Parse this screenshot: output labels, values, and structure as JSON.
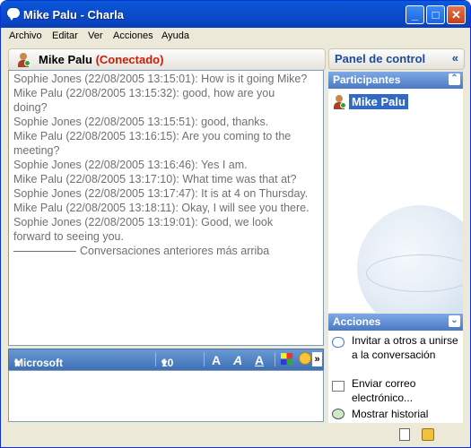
{
  "window": {
    "title": "Mike Palu - Charla",
    "min": "_",
    "max": "□",
    "close": "✕"
  },
  "menu": [
    "Archivo",
    "Editar",
    "Ver",
    "Acciones",
    "Ayuda"
  ],
  "chat": {
    "contact_name": "Mike Palu",
    "contact_status": "(Conectado)",
    "messages": [
      "Sophie Jones  (22/08/2005 13:15:01): How is it going Mike?",
      "Mike Palu  (22/08/2005 13:15:32): good, how are you doing?",
      "Sophie Jones  (22/08/2005 13:15:51): good, thanks.",
      "Mike Palu  (22/08/2005 13:16:15): Are you coming to the meeting?",
      "Sophie Jones  (22/08/2005 13:16:46): Yes I am.",
      "Mike Palu  (22/08/2005 13:17:10): What time was that at?",
      "Sophie Jones  (22/08/2005 13:17:47): It is at 4 on Thursday.",
      "Mike Palu  (22/08/2005 13:18:11): Okay, I will see you there.",
      "Sophie Jones  (22/08/2005 13:19:01): Good, we look forward to seeing you."
    ],
    "separator": "Conversaciones anteriores más arriba"
  },
  "format_toolbar": {
    "font": "Microsoft Sans Serif",
    "size": "10",
    "bold": "A",
    "italic": "A",
    "underline": "A",
    "more": "»"
  },
  "panel": {
    "title": "Panel de control",
    "collapse": "«",
    "participants_label": "Participantes",
    "participants": [
      "Mike Palu"
    ],
    "actions_label": "Acciones",
    "actions": [
      "Invitar a otros a unirse a la conversación",
      "Enviar correo electrónico...",
      "Mostrar historial"
    ]
  },
  "colors": {
    "title_bar": "#0a48c7",
    "status_online": "#c81e0a",
    "section_bar": "#4b79c4",
    "selection": "#316ac5"
  }
}
